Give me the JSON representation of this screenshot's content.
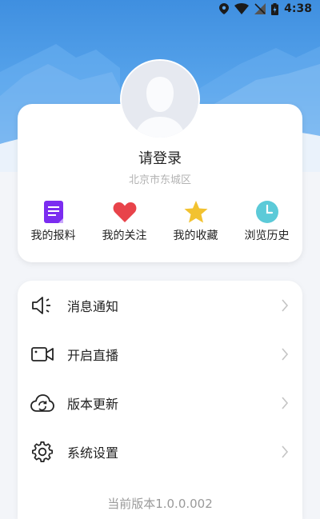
{
  "status_bar": {
    "time": "4:38"
  },
  "profile": {
    "login_prompt": "请登录",
    "location": "北京市东城区"
  },
  "quick_actions": [
    {
      "label": "我的报料",
      "icon": "report-icon",
      "color": "#7b2cf0"
    },
    {
      "label": "我的关注",
      "icon": "heart-icon",
      "color": "#e8434a"
    },
    {
      "label": "我的收藏",
      "icon": "star-icon",
      "color": "#f2c230"
    },
    {
      "label": "浏览历史",
      "icon": "clock-icon",
      "color": "#5ccad8"
    }
  ],
  "menu": [
    {
      "label": "消息通知",
      "icon": "speaker-icon"
    },
    {
      "label": "开启直播",
      "icon": "video-camera-icon"
    },
    {
      "label": "版本更新",
      "icon": "cloud-refresh-icon"
    },
    {
      "label": "系统设置",
      "icon": "gear-icon"
    }
  ],
  "version_text": "当前版本1.0.0.002",
  "colors": {
    "header": "#4a97e4",
    "background": "#f3f5f9",
    "card": "#ffffff"
  }
}
